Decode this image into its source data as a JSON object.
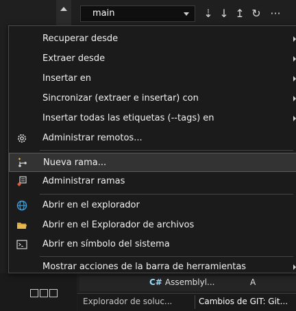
{
  "toolbar": {
    "branch": "main",
    "more": "···"
  },
  "menu": {
    "items": [
      {
        "label": "Recuperar desde",
        "submenu": true
      },
      {
        "label": "Extraer desde",
        "submenu": true
      },
      {
        "label": "Insertar en",
        "submenu": true
      },
      {
        "label": "Sincronizar (extraer e insertar) con",
        "submenu": true
      },
      {
        "label": "Insertar todas las etiquetas (--tags) en",
        "submenu": true
      },
      {
        "label": "Administrar remotos...",
        "icon": "gear-icon"
      },
      {
        "label": "Nueva rama...",
        "icon": "new-branch-icon"
      },
      {
        "label": "Administrar ramas",
        "icon": "manage-branches-icon"
      },
      {
        "label": "Abrir en el explorador",
        "icon": "globe-icon"
      },
      {
        "label": "Abrir en el Explorador de archivos",
        "icon": "folder-icon"
      },
      {
        "label": "Abrir en símbolo del sistema",
        "icon": "terminal-icon"
      },
      {
        "label": "Mostrar acciones de la barra de herramientas",
        "submenu": true
      }
    ]
  },
  "file_list": {
    "lang": "C#",
    "name": "Assemblyl...",
    "status": "A"
  },
  "tabs": {
    "solution_explorer": "Explorador de soluc...",
    "git_changes": "Cambios de GIT: Git..."
  },
  "colors": {
    "menu_bg": "#1b1b1b",
    "hover_bg": "#333333",
    "accent_blue": "#3c9cdb"
  }
}
